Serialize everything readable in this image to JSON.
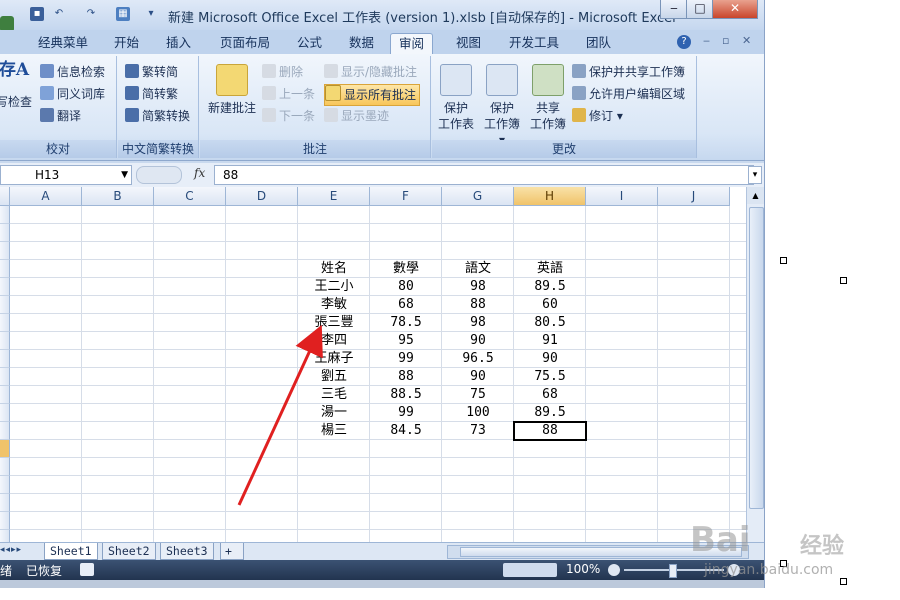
{
  "window": {
    "title": "新建 Microsoft Office Excel 工作表 (version 1).xlsb [自动保存的] - Microsoft Excel",
    "min_label": "‒",
    "max_label": "□",
    "close_label": "✕"
  },
  "tabs": [
    "经典菜单",
    "开始",
    "插入",
    "页面布局",
    "公式",
    "数据",
    "审阅",
    "视图",
    "开发工具",
    "团队"
  ],
  "active_tab": "审阅",
  "help_label": "?",
  "ribbon": {
    "proofing": {
      "title": "校对",
      "big_label_top": "存A",
      "big_label_bottom": "写检查",
      "items": [
        "信息检索",
        "同义词库",
        "翻译"
      ]
    },
    "chinese": {
      "title": "中文简繁转换",
      "items": [
        "繁转简",
        "简转繁",
        "简繁转换"
      ]
    },
    "comments": {
      "title": "批注",
      "new_comment": "新建批注",
      "items": [
        "删除",
        "上一条",
        "下一条"
      ],
      "items2": [
        "显示/隐藏批注",
        "显示所有批注",
        "显示墨迹"
      ]
    },
    "changes": {
      "title": "更改",
      "protect_sheet": [
        "保护",
        "工作表"
      ],
      "protect_book": [
        "保护",
        "工作簿 ▾"
      ],
      "share_book": [
        "共享",
        "工作簿"
      ],
      "items": [
        "保护并共享工作簿",
        "允许用户编辑区域",
        "修订 ▾"
      ]
    }
  },
  "formula_bar": {
    "name_box": "H13",
    "fx": "fx",
    "value": "88"
  },
  "columns": [
    "A",
    "B",
    "C",
    "D",
    "E",
    "F",
    "G",
    "H",
    "I",
    "J"
  ],
  "selected_column": "H",
  "row_numbers": [
    "",
    "",
    "",
    "",
    "",
    "",
    "",
    "",
    "",
    "",
    "",
    "",
    "",
    "",
    "",
    "",
    "",
    "",
    ""
  ],
  "table": {
    "headers": [
      "姓名",
      "數學",
      "語文",
      "英語"
    ],
    "rows": [
      [
        "王二小",
        "80",
        "98",
        "89.5"
      ],
      [
        "李敏",
        "68",
        "88",
        "60"
      ],
      [
        "張三豐",
        "78.5",
        "98",
        "80.5"
      ],
      [
        "李四",
        "95",
        "90",
        "91"
      ],
      [
        "王麻子",
        "99",
        "96.5",
        "90"
      ],
      [
        "劉五",
        "88",
        "90",
        "75.5"
      ],
      [
        "三毛",
        "88.5",
        "75",
        "68"
      ],
      [
        "湯一",
        "99",
        "100",
        "89.5"
      ],
      [
        "楊三",
        "84.5",
        "73",
        "88"
      ]
    ]
  },
  "sheets": [
    "Sheet1",
    "Sheet2",
    "Sheet3"
  ],
  "active_sheet": "Sheet1",
  "status": {
    "left1": "绪",
    "left2": "已恢复",
    "zoom": "100%"
  },
  "watermark": {
    "brand": "Bai",
    "text": "经验",
    "url": "jingyan.baidu.com"
  },
  "colors": {
    "arrow": "#e02020",
    "selected_header": "#f0c36a",
    "status_bar": "#2b3f5c"
  }
}
